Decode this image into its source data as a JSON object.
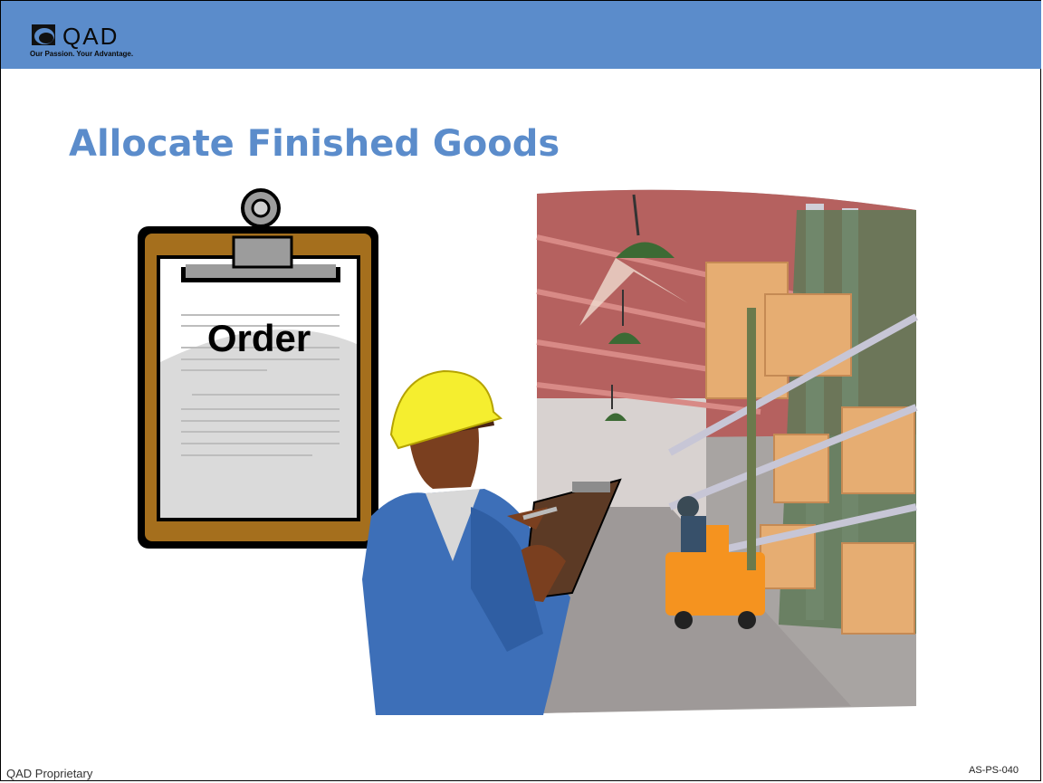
{
  "header": {
    "logo_name": "QAD",
    "logo_tagline": "Our Passion. Your Advantage.",
    "logo_icon": "qad-logo-icon",
    "bar_color": "#5b8ccb"
  },
  "slide": {
    "title": "Allocate Finished Goods",
    "title_color": "#5b8ccb"
  },
  "illustration": {
    "clipboard_label": "Order",
    "clipboard_icon": "clipboard-icon",
    "warehouse_icon": "warehouse-scene-icon",
    "worker_icon": "warehouse-worker-icon",
    "forklift_icon": "forklift-icon"
  },
  "footer": {
    "left_text": "QAD Proprietary",
    "right_text": "AS-PS-040"
  }
}
